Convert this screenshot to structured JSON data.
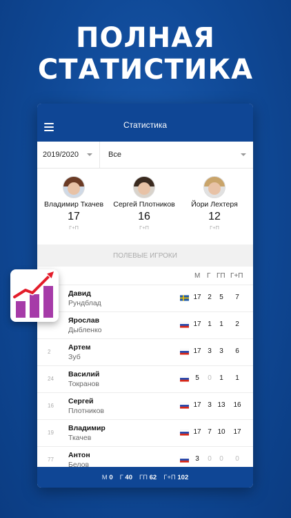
{
  "promo": {
    "line1": "ПОЛНАЯ",
    "line2": "СТАТИСТИКА"
  },
  "appbar": {
    "title": "Статистика"
  },
  "filters": {
    "season": "2019/2020",
    "team": "Все"
  },
  "leaders": [
    {
      "name": "Владимир Ткачев",
      "value": "17",
      "sub": "Г+П"
    },
    {
      "name": "Сергей Плотников",
      "value": "16",
      "sub": "Г+П"
    },
    {
      "name": "Йори Лехтеря",
      "value": "12",
      "sub": "Г+П"
    }
  ],
  "section_title": "ПОЛЕВЫЕ ИГРОКИ",
  "table": {
    "columns": [
      "М",
      "Г",
      "ГП",
      "Г+П"
    ],
    "rows": [
      {
        "num": "",
        "first": "Давид",
        "last": "Рундблад",
        "flag": "sweden",
        "m": "17",
        "g": "2",
        "gp": "5",
        "gpp": "7"
      },
      {
        "num": "",
        "first": "Ярослав",
        "last": "Дыбленко",
        "flag": "russia",
        "m": "17",
        "g": "1",
        "gp": "1",
        "gpp": "2"
      },
      {
        "num": "2",
        "first": "Артем",
        "last": "Зуб",
        "flag": "russia",
        "m": "17",
        "g": "3",
        "gp": "3",
        "gpp": "6"
      },
      {
        "num": "24",
        "first": "Василий",
        "last": "Токранов",
        "flag": "russia",
        "m": "5",
        "g": "0",
        "gp": "1",
        "gpp": "1"
      },
      {
        "num": "16",
        "first": "Сергей",
        "last": "Плотников",
        "flag": "russia",
        "m": "17",
        "g": "3",
        "gp": "13",
        "gpp": "16"
      },
      {
        "num": "19",
        "first": "Владимир",
        "last": "Ткачев",
        "flag": "russia",
        "m": "17",
        "g": "7",
        "gp": "10",
        "gpp": "17"
      },
      {
        "num": "77",
        "first": "Антон",
        "last": "Белов",
        "flag": "russia",
        "m": "3",
        "g": "0",
        "gp": "0",
        "gpp": "0"
      }
    ]
  },
  "footer": [
    {
      "label": "М",
      "value": "0"
    },
    {
      "label": "Г",
      "value": "40"
    },
    {
      "label": "ГП",
      "value": "62"
    },
    {
      "label": "Г+П",
      "value": "102"
    }
  ],
  "colors": {
    "primary": "#0f4695",
    "badge_bars": "#a63ba8",
    "badge_arrow": "#e31d2b"
  }
}
